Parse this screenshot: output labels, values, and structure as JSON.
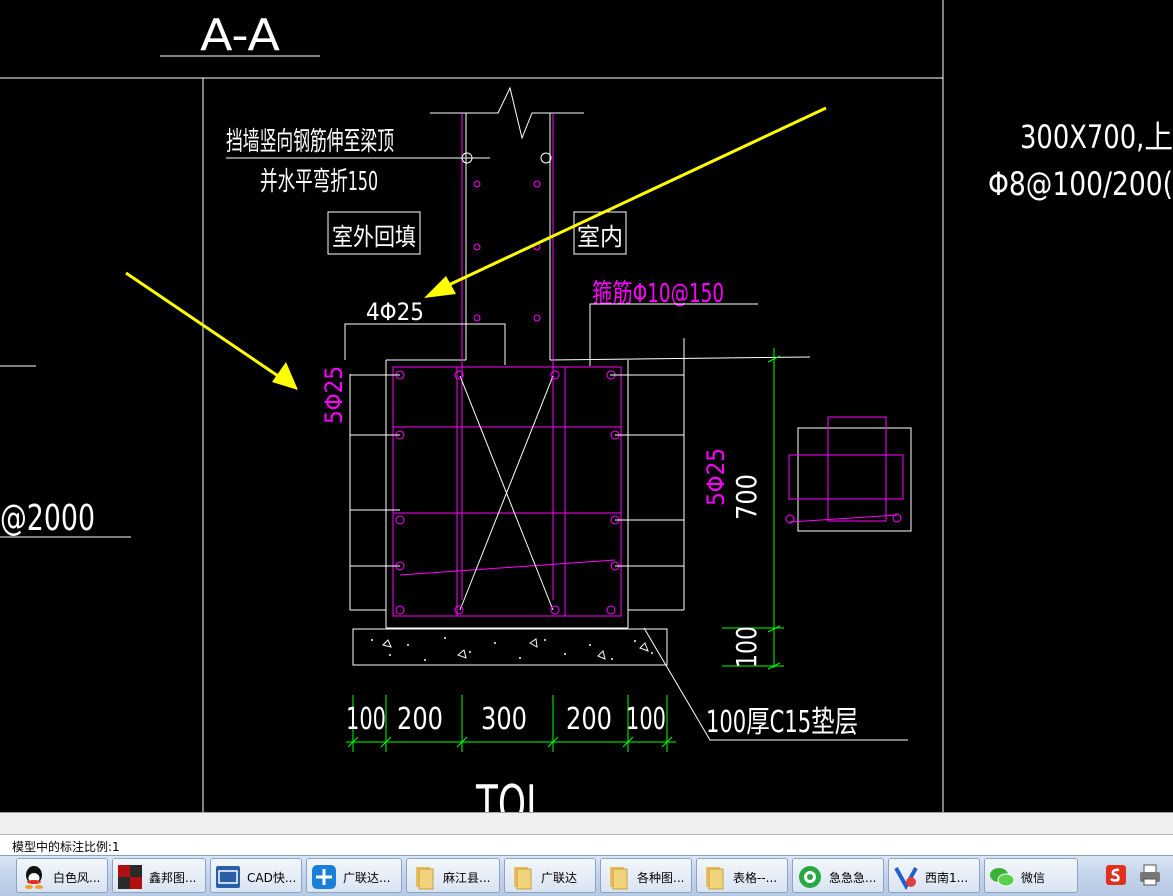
{
  "drawing": {
    "section_title": "A-A",
    "note_rebar_line1": "挡墙竖向钢筋伸至梁顶",
    "note_rebar_line2": "并水平弯折150",
    "label_outdoor": "室外回填",
    "label_indoor": "室内",
    "top_bar_label": "4Φ25",
    "stirrup_label": "箍筋Φ10@150",
    "side_bar_left": "5Φ25",
    "side_bar_right": "5Φ25",
    "dim_height": "700",
    "dim_pad": "100",
    "dim_bottom": [
      "100",
      "200",
      "300",
      "200",
      "100"
    ],
    "pad_label": "100厚C15垫层",
    "beam_name": "TQL",
    "right_note_line1": "300X700,上",
    "right_note_line2": "Φ8@100/200(",
    "left_note": "@2000",
    "colors": {
      "line": "#ffffff",
      "rebar": "#ff00ff",
      "dimension": "#00ff00",
      "arrow": "#ffff00",
      "bg": "#000000"
    }
  },
  "status": {
    "text": "模型中的标注比例:1"
  },
  "taskbar": {
    "items": [
      {
        "label": "白色风...",
        "icon": "qq-icon"
      },
      {
        "label": "鑫邦图...",
        "icon": "xinbang-icon"
      },
      {
        "label": "CAD快...",
        "icon": "cad-icon"
      },
      {
        "label": "广联达...",
        "icon": "glodon-icon"
      },
      {
        "label": "麻江县...",
        "icon": "folder-icon"
      },
      {
        "label": "广联达",
        "icon": "folder-icon"
      },
      {
        "label": "各种图...",
        "icon": "folder-icon"
      },
      {
        "label": "表格--...",
        "icon": "folder-icon"
      },
      {
        "label": "急急急...",
        "icon": "browser-icon"
      },
      {
        "label": "西南1...",
        "icon": "wps-icon"
      },
      {
        "label": "微信",
        "icon": "wechat-icon"
      }
    ]
  }
}
